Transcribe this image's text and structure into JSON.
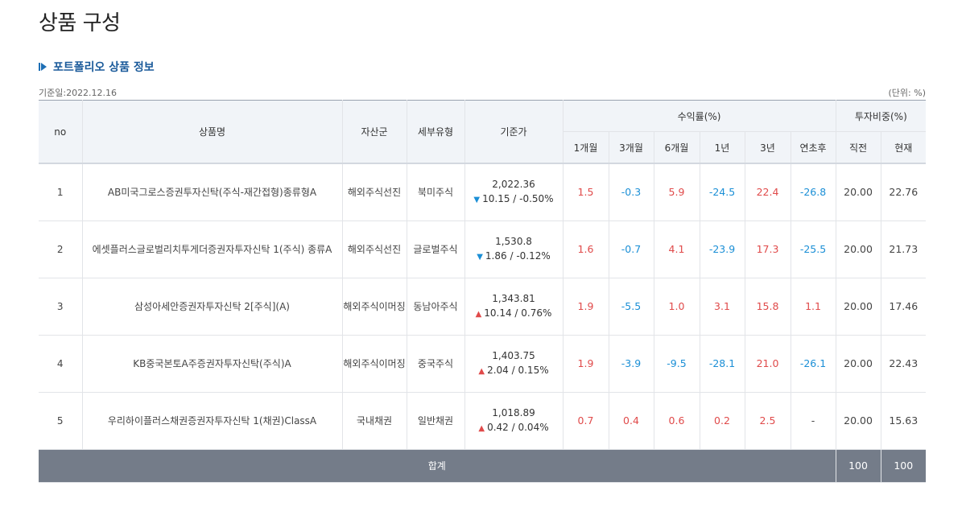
{
  "page_title": "상품 구성",
  "section_title": "포트폴리오 상품 정보",
  "base_date": "기준일:2022.12.16",
  "unit": "(단위: %)",
  "headers": {
    "no": "no",
    "name": "상품명",
    "asset": "자산군",
    "sub": "세부유형",
    "price": "기준가",
    "returns": "수익률(%)",
    "weight": "투자비중(%)",
    "r1m": "1개월",
    "r3m": "3개월",
    "r6m": "6개월",
    "r1y": "1년",
    "r3y": "3년",
    "ytd": "연초후",
    "w_prev": "직전",
    "w_cur": "현재"
  },
  "rows": [
    {
      "no": "1",
      "name": "AB미국그로스증권투자신탁(주식-재간접형)종류형A",
      "asset": "해외주식선진",
      "sub": "북미주식",
      "price": "2,022.36",
      "dir": "down",
      "change": "10.15 / -0.50%",
      "r1m": "1.5",
      "r3m": "-0.3",
      "r6m": "5.9",
      "r1y": "-24.5",
      "r3y": "22.4",
      "ytd": "-26.8",
      "w_prev": "20.00",
      "w_cur": "22.76"
    },
    {
      "no": "2",
      "name": "에셋플러스글로벌리치투게더증권자투자신탁 1(주식) 종류A",
      "asset": "해외주식선진",
      "sub": "글로벌주식",
      "price": "1,530.8",
      "dir": "down",
      "change": "1.86 / -0.12%",
      "r1m": "1.6",
      "r3m": "-0.7",
      "r6m": "4.1",
      "r1y": "-23.9",
      "r3y": "17.3",
      "ytd": "-25.5",
      "w_prev": "20.00",
      "w_cur": "21.73"
    },
    {
      "no": "3",
      "name": "삼성아세안증권자투자신탁 2[주식](A)",
      "asset": "해외주식이머징",
      "sub": "동남아주식",
      "price": "1,343.81",
      "dir": "up",
      "change": "10.14 / 0.76%",
      "r1m": "1.9",
      "r3m": "-5.5",
      "r6m": "1.0",
      "r1y": "3.1",
      "r3y": "15.8",
      "ytd": "1.1",
      "w_prev": "20.00",
      "w_cur": "17.46"
    },
    {
      "no": "4",
      "name": "KB중국본토A주증권자투자신탁(주식)A",
      "asset": "해외주식이머징",
      "sub": "중국주식",
      "price": "1,403.75",
      "dir": "up",
      "change": "2.04 / 0.15%",
      "r1m": "1.9",
      "r3m": "-3.9",
      "r6m": "-9.5",
      "r1y": "-28.1",
      "r3y": "21.0",
      "ytd": "-26.1",
      "w_prev": "20.00",
      "w_cur": "22.43"
    },
    {
      "no": "5",
      "name": "우리하이플러스채권증권자투자신탁 1(채권)ClassA",
      "asset": "국내채권",
      "sub": "일반채권",
      "price": "1,018.89",
      "dir": "up",
      "change": "0.42 / 0.04%",
      "r1m": "0.7",
      "r3m": "0.4",
      "r6m": "0.6",
      "r1y": "0.2",
      "r3y": "2.5",
      "ytd": "-",
      "w_prev": "20.00",
      "w_cur": "15.63"
    }
  ],
  "total": {
    "label": "합계",
    "w_prev": "100",
    "w_cur": "100"
  },
  "colors": {
    "positive": "#e04a4a",
    "negative": "#1b8fd6",
    "header_bg": "#f1f4f8",
    "footer_bg": "#747c89"
  }
}
